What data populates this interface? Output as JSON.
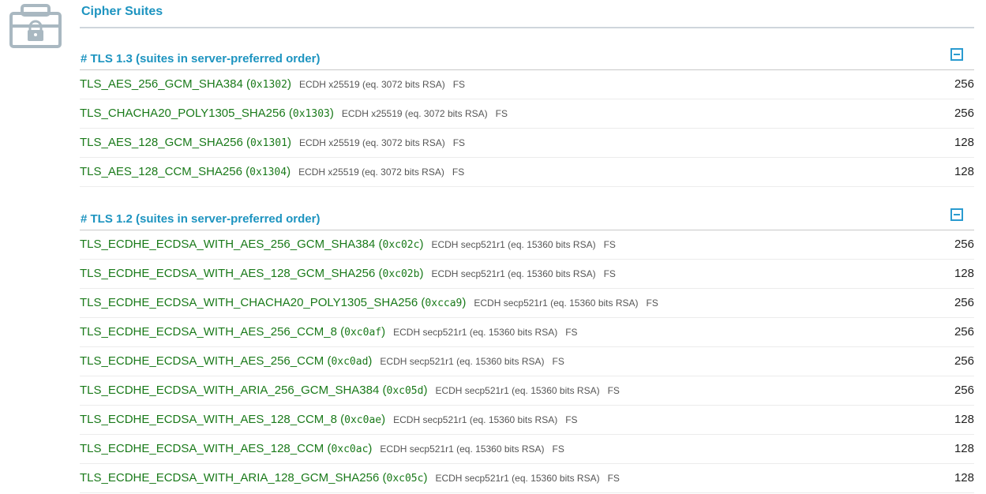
{
  "section": {
    "title": "Cipher Suites",
    "icon": "lock-icon"
  },
  "colors": {
    "accent": "#1d94c0",
    "suite_name": "#1a7a1a",
    "meta_text": "#555555",
    "icon_gray": "#a9b8c1"
  },
  "groups": [
    {
      "title": "# TLS 1.3 (suites in server-preferred order)",
      "collapse_icon": "minus-square-icon",
      "suites": [
        {
          "name": "TLS_AES_256_GCM_SHA384",
          "code": "0x1302",
          "kx": "ECDH x25519 (eq. 3072 bits RSA)",
          "fs": "FS",
          "bits": "256"
        },
        {
          "name": "TLS_CHACHA20_POLY1305_SHA256",
          "code": "0x1303",
          "kx": "ECDH x25519 (eq. 3072 bits RSA)",
          "fs": "FS",
          "bits": "256"
        },
        {
          "name": "TLS_AES_128_GCM_SHA256",
          "code": "0x1301",
          "kx": "ECDH x25519 (eq. 3072 bits RSA)",
          "fs": "FS",
          "bits": "128"
        },
        {
          "name": "TLS_AES_128_CCM_SHA256",
          "code": "0x1304",
          "kx": "ECDH x25519 (eq. 3072 bits RSA)",
          "fs": "FS",
          "bits": "128"
        }
      ]
    },
    {
      "title": "# TLS 1.2 (suites in server-preferred order)",
      "collapse_icon": "minus-square-icon",
      "suites": [
        {
          "name": "TLS_ECDHE_ECDSA_WITH_AES_256_GCM_SHA384",
          "code": "0xc02c",
          "kx": "ECDH secp521r1 (eq. 15360 bits RSA)",
          "fs": "FS",
          "bits": "256"
        },
        {
          "name": "TLS_ECDHE_ECDSA_WITH_AES_128_GCM_SHA256",
          "code": "0xc02b",
          "kx": "ECDH secp521r1 (eq. 15360 bits RSA)",
          "fs": "FS",
          "bits": "128"
        },
        {
          "name": "TLS_ECDHE_ECDSA_WITH_CHACHA20_POLY1305_SHA256",
          "code": "0xcca9",
          "kx": "ECDH secp521r1 (eq. 15360 bits RSA)",
          "fs": "FS",
          "bits": "256"
        },
        {
          "name": "TLS_ECDHE_ECDSA_WITH_AES_256_CCM_8",
          "code": "0xc0af",
          "kx": "ECDH secp521r1 (eq. 15360 bits RSA)",
          "fs": "FS",
          "bits": "256"
        },
        {
          "name": "TLS_ECDHE_ECDSA_WITH_AES_256_CCM",
          "code": "0xc0ad",
          "kx": "ECDH secp521r1 (eq. 15360 bits RSA)",
          "fs": "FS",
          "bits": "256"
        },
        {
          "name": "TLS_ECDHE_ECDSA_WITH_ARIA_256_GCM_SHA384",
          "code": "0xc05d",
          "kx": "ECDH secp521r1 (eq. 15360 bits RSA)",
          "fs": "FS",
          "bits": "256"
        },
        {
          "name": "TLS_ECDHE_ECDSA_WITH_AES_128_CCM_8",
          "code": "0xc0ae",
          "kx": "ECDH secp521r1 (eq. 15360 bits RSA)",
          "fs": "FS",
          "bits": "128"
        },
        {
          "name": "TLS_ECDHE_ECDSA_WITH_AES_128_CCM",
          "code": "0xc0ac",
          "kx": "ECDH secp521r1 (eq. 15360 bits RSA)",
          "fs": "FS",
          "bits": "128"
        },
        {
          "name": "TLS_ECDHE_ECDSA_WITH_ARIA_128_GCM_SHA256",
          "code": "0xc05c",
          "kx": "ECDH secp521r1 (eq. 15360 bits RSA)",
          "fs": "FS",
          "bits": "128"
        }
      ]
    }
  ]
}
